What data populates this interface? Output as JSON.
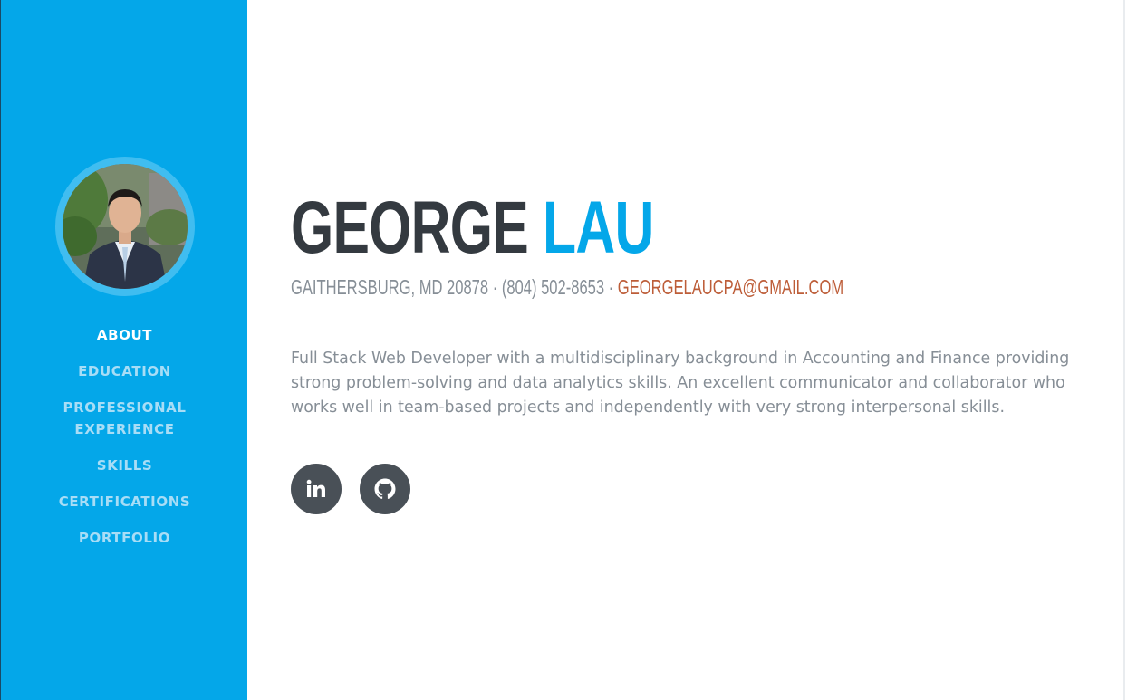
{
  "profile": {
    "first_name": "George",
    "last_name": "Lau",
    "address": "Gaithersburg, MD 20878",
    "separator": " · ",
    "phone": "(804) 502-8653",
    "email": "georgelaucpa@gmail.com",
    "bio": "Full Stack Web Developer with a multidisciplinary background in Accounting and Finance providing strong problem-solving and data analytics skills. An excellent communicator and collaborator who works well in team-based projects and independently with very strong interpersonal skills."
  },
  "nav": {
    "items": [
      {
        "label": "About",
        "active": true
      },
      {
        "label": "Education",
        "active": false
      },
      {
        "label": "Professional Experience",
        "active": false
      },
      {
        "label": "Skills",
        "active": false
      },
      {
        "label": "Certifications",
        "active": false
      },
      {
        "label": "Portfolio",
        "active": false
      }
    ]
  },
  "social": {
    "items": [
      {
        "icon": "linkedin-icon"
      },
      {
        "icon": "github-icon"
      }
    ]
  },
  "colors": {
    "sidebar_bg": "#04a7e9",
    "accent": "#04a7e9",
    "heading_dark": "#343a40",
    "muted_text": "#868e96",
    "email_link": "#bd5d38",
    "social_bg": "#495057"
  }
}
